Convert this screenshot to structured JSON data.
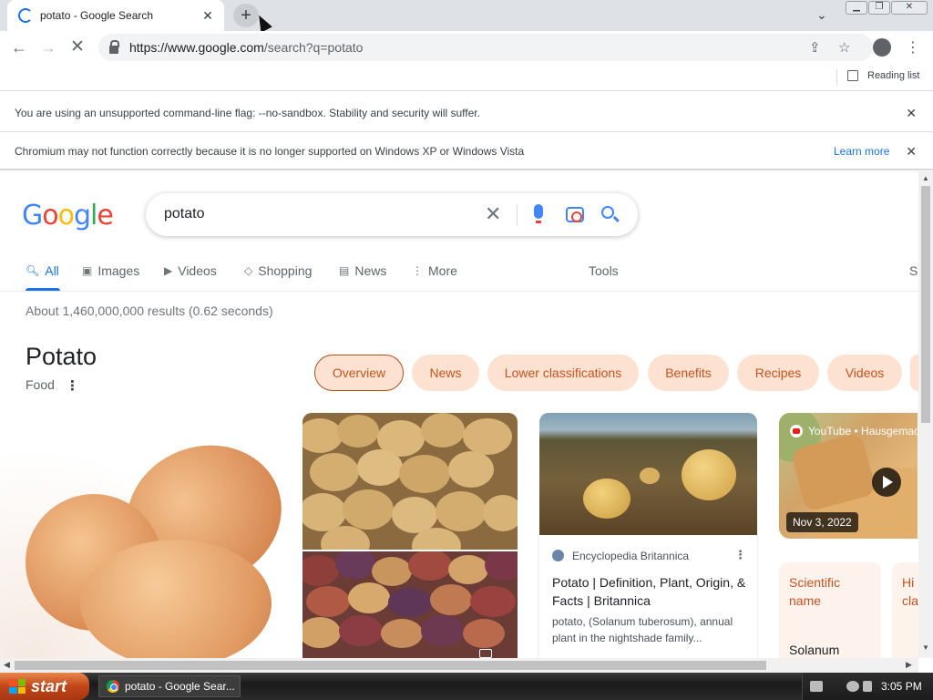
{
  "browser": {
    "tab_title": "potato - Google Search",
    "url_domain": "https://www.google.com",
    "url_path": "/search?q=potato",
    "reading_list": "Reading list"
  },
  "infobars": {
    "flag_warning": "You are using an unsupported command-line flag: --no-sandbox. Stability and security will suffer.",
    "os_warning": "Chromium may not function correctly because it is no longer supported on Windows XP or Windows Vista",
    "learn_more": "Learn more"
  },
  "search": {
    "query": "potato",
    "tabs": [
      "All",
      "Images",
      "Videos",
      "Shopping",
      "News",
      "More"
    ],
    "tools": "Tools",
    "edge_letter": "S",
    "stats": "About 1,460,000,000 results (0.62 seconds)"
  },
  "knowledge_panel": {
    "title": "Potato",
    "subtitle": "Food",
    "chips": [
      "Overview",
      "News",
      "Lower classifications",
      "Benefits",
      "Recipes",
      "Videos"
    ]
  },
  "result_card": {
    "source": "Encyclopedia Britannica",
    "title": "Potato | Definition, Plant, Origin, & Facts | Britannica",
    "snippet": "potato, (Solanum tuberosum), annual plant in the nightshade family..."
  },
  "video": {
    "channel": "YouTube • Hausgemac",
    "date": "Nov 3, 2022"
  },
  "facts": [
    {
      "key": "Scientific name",
      "value": "Solanum"
    },
    {
      "key": "Hi cla",
      "value": ""
    }
  ],
  "taskbar": {
    "start": "start",
    "task_title": "potato - Google Sear...",
    "clock": "3:05 PM"
  },
  "colors": {
    "google_blue": "#4285f4",
    "google_red": "#ea4335",
    "google_yellow": "#fbbc05",
    "google_green": "#34a853",
    "chip_bg": "#fde2d2",
    "chip_text": "#c5531f",
    "link_blue": "#1a73e8"
  }
}
